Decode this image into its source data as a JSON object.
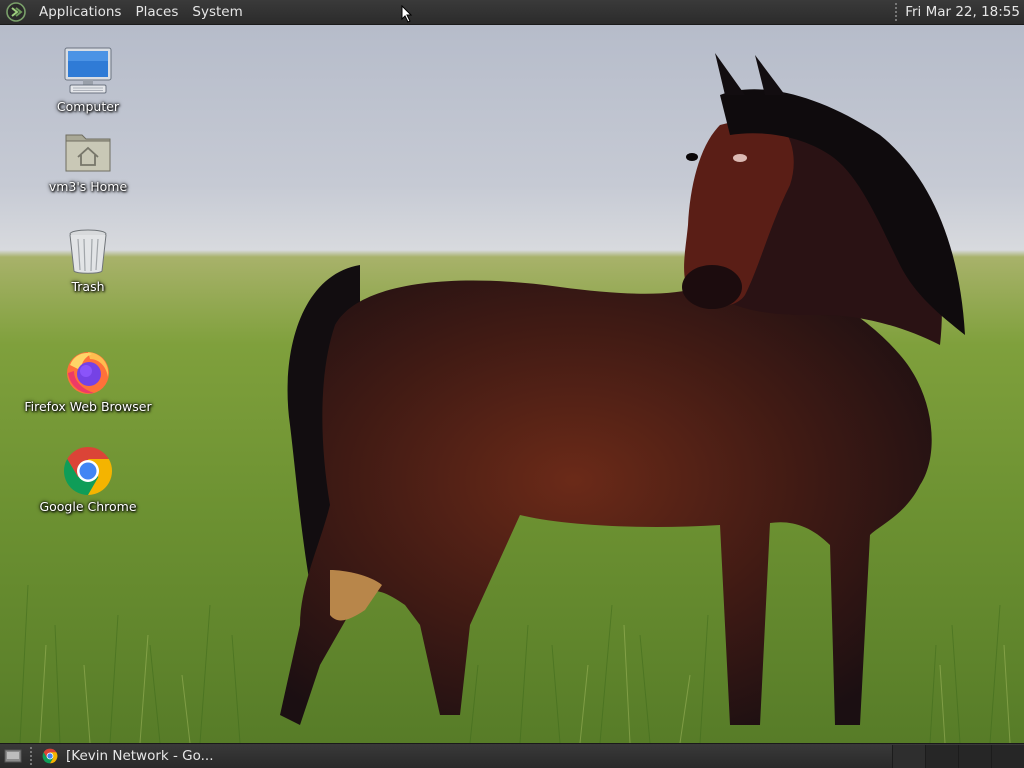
{
  "top_panel": {
    "menus": [
      "Applications",
      "Places",
      "System"
    ],
    "clock": "Fri Mar 22, 18:55"
  },
  "desktop": {
    "icons": [
      {
        "label": "Computer",
        "icon": "computer-icon"
      },
      {
        "label": "vm3's Home",
        "icon": "home-folder-icon"
      },
      {
        "label": "Trash",
        "icon": "trash-icon"
      },
      {
        "label": "Firefox Web Browser",
        "icon": "firefox-icon"
      },
      {
        "label": "Google Chrome",
        "icon": "chrome-icon"
      }
    ]
  },
  "taskbar": {
    "tasks": [
      {
        "label": "[Kevin Network - Go...",
        "icon": "chrome-icon"
      }
    ],
    "workspace_count": 4
  },
  "colors": {
    "panel": "#2e2e2e",
    "panel_text": "#e6e6e6"
  }
}
